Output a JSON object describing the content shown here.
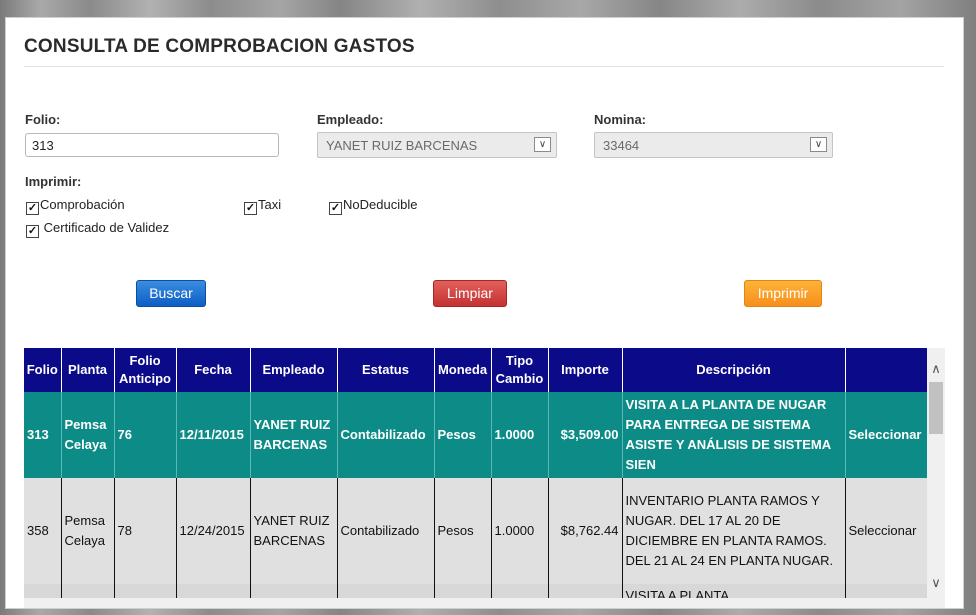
{
  "page": {
    "title": "CONSULTA DE COMPROBACION GASTOS"
  },
  "form": {
    "folio_label": "Folio:",
    "folio_value": "313",
    "empleado_label": "Empleado:",
    "empleado_value": "YANET RUIZ BARCENAS",
    "nomina_label": "Nomina:",
    "nomina_value": "33464",
    "imprimir_label": "Imprimir:",
    "checks": {
      "comprobacion": "Comprobación",
      "taxi": "Taxi",
      "nodeducible": "NoDeducible",
      "certificado": "Certificado de Validez"
    }
  },
  "buttons": {
    "buscar": "Buscar",
    "limpiar": "Limpiar",
    "imprimir": "Imprimir"
  },
  "colors": {
    "header_bg": "#0b0b8a",
    "selected_row": "#0d8c87",
    "btn_blue": "#0c5fc4",
    "btn_red": "#c33230",
    "btn_orange": "#f6901c"
  },
  "table": {
    "headers": {
      "folio": "Folio",
      "planta": "Planta",
      "folio_anticipo": "Folio Anticipo",
      "fecha": "Fecha",
      "empleado": "Empleado",
      "estatus": "Estatus",
      "moneda": "Moneda",
      "tipo_cambio": "Tipo Cambio",
      "importe": "Importe",
      "descripcion": "Descripción"
    },
    "rows": [
      {
        "folio": "313",
        "planta": "Pemsa Celaya",
        "folio_anticipo": "76",
        "fecha": "12/11/2015",
        "empleado": "YANET RUIZ BARCENAS",
        "estatus": "Contabilizado",
        "moneda": "Pesos",
        "tipo_cambio": "1.0000",
        "importe": "$3,509.00",
        "descripcion": "VISITA A LA PLANTA DE NUGAR PARA ENTREGA DE SISTEMA ASISTE Y ANÁLISIS DE SISTEMA SIEN",
        "accion": "Seleccionar"
      },
      {
        "folio": "358",
        "planta": "Pemsa Celaya",
        "folio_anticipo": "78",
        "fecha": "12/24/2015",
        "empleado": "YANET RUIZ BARCENAS",
        "estatus": "Contabilizado",
        "moneda": "Pesos",
        "tipo_cambio": "1.0000",
        "importe": "$8,762.44",
        "descripcion": "INVENTARIO PLANTA RAMOS Y NUGAR. DEL 17 AL 20 DE DICIEMBRE EN PLANTA RAMOS. DEL 21 AL 24 EN PLANTA NUGAR.",
        "accion": "Seleccionar"
      },
      {
        "descripcion": "VISITA A PLANTA"
      }
    ]
  }
}
